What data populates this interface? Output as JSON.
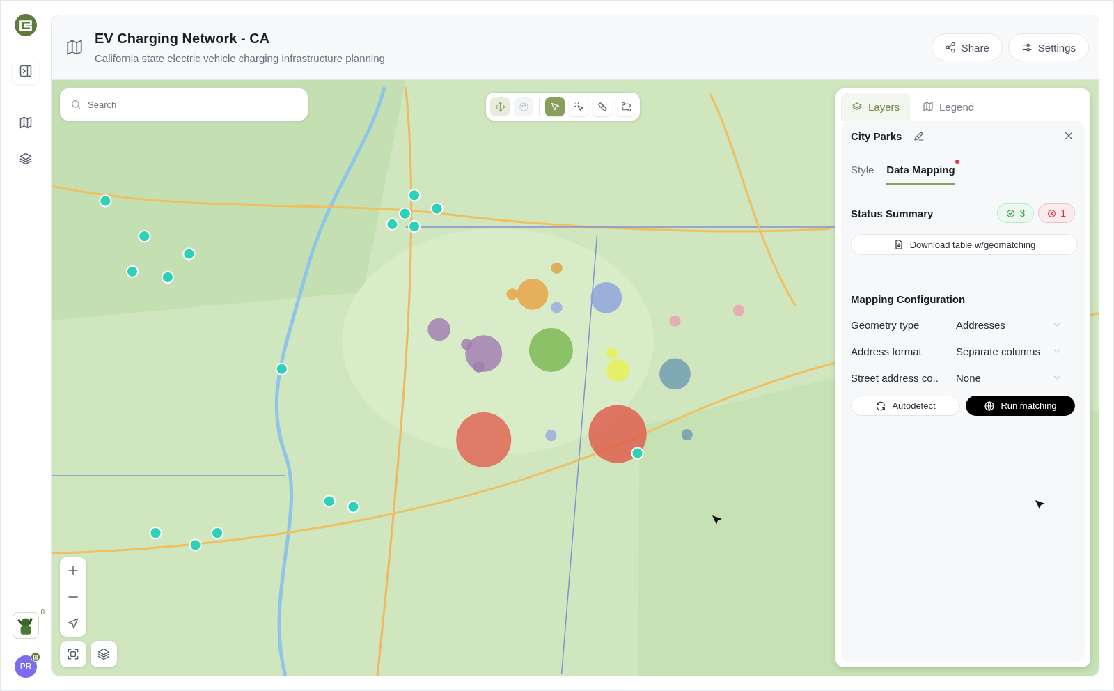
{
  "header": {
    "title": "EV Charging Network - CA",
    "subtitle": "California state electric vehicle charging infrastructure planning",
    "buttons": [
      {
        "kind": "share",
        "label": "Share"
      },
      {
        "kind": "settings",
        "label": "Settings"
      }
    ]
  },
  "rail": {
    "items": [
      {
        "kind": "panel"
      },
      {
        "kind": "map"
      },
      {
        "kind": "layers"
      }
    ],
    "game_badge": "0"
  },
  "user": {
    "initials": "PR"
  },
  "search": {
    "placeholder": "Search"
  },
  "toolbar": [
    {
      "kind": "move",
      "selected": false,
      "disabled": false
    },
    {
      "kind": "paint",
      "selected": false,
      "disabled": true
    },
    {
      "kind": "select",
      "selected": true,
      "disabled": false
    },
    {
      "kind": "magic",
      "selected": false,
      "disabled": false
    },
    {
      "kind": "ruler",
      "selected": false,
      "disabled": false
    },
    {
      "kind": "route",
      "selected": false,
      "disabled": false
    }
  ],
  "panel": {
    "tabs": [
      {
        "kind": "layers",
        "label": "Layers",
        "selected": true
      },
      {
        "kind": "legend",
        "label": "Legend",
        "selected": false
      }
    ],
    "layer_name": "City Parks",
    "subtabs": [
      {
        "label": "Style",
        "selected": false,
        "alert": false
      },
      {
        "label": "Data Mapping",
        "selected": true,
        "alert": true
      }
    ],
    "status_title": "Status Summary",
    "status_counts": [
      {
        "kind": "success",
        "count": "3"
      },
      {
        "kind": "error",
        "count": "1"
      }
    ],
    "download_label": "Download table w/geomatching",
    "config_title": "Mapping Configuration",
    "fields": [
      {
        "label": "Geometry type",
        "value": "Addresses"
      },
      {
        "label": "Address format",
        "value": "Separate columns"
      },
      {
        "label": "Street address co..",
        "value": "None"
      }
    ],
    "autodetect_label": "Autodetect",
    "run_label": "Run matching"
  }
}
